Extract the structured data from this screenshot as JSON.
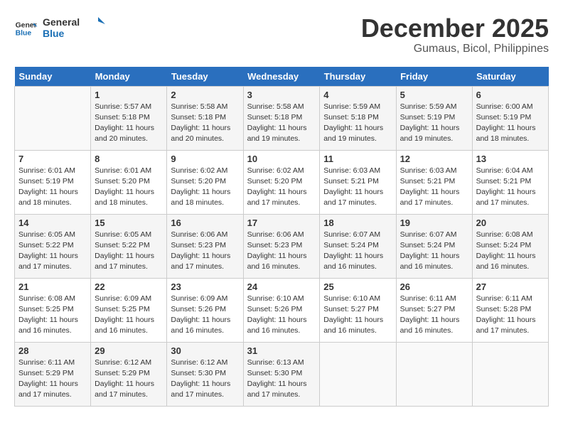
{
  "logo": {
    "line1": "General",
    "line2": "Blue"
  },
  "title": "December 2025",
  "location": "Gumaus, Bicol, Philippines",
  "days_header": [
    "Sunday",
    "Monday",
    "Tuesday",
    "Wednesday",
    "Thursday",
    "Friday",
    "Saturday"
  ],
  "weeks": [
    [
      {
        "day": "",
        "info": ""
      },
      {
        "day": "1",
        "info": "Sunrise: 5:57 AM\nSunset: 5:18 PM\nDaylight: 11 hours\nand 20 minutes."
      },
      {
        "day": "2",
        "info": "Sunrise: 5:58 AM\nSunset: 5:18 PM\nDaylight: 11 hours\nand 20 minutes."
      },
      {
        "day": "3",
        "info": "Sunrise: 5:58 AM\nSunset: 5:18 PM\nDaylight: 11 hours\nand 19 minutes."
      },
      {
        "day": "4",
        "info": "Sunrise: 5:59 AM\nSunset: 5:18 PM\nDaylight: 11 hours\nand 19 minutes."
      },
      {
        "day": "5",
        "info": "Sunrise: 5:59 AM\nSunset: 5:19 PM\nDaylight: 11 hours\nand 19 minutes."
      },
      {
        "day": "6",
        "info": "Sunrise: 6:00 AM\nSunset: 5:19 PM\nDaylight: 11 hours\nand 18 minutes."
      }
    ],
    [
      {
        "day": "7",
        "info": "Sunrise: 6:01 AM\nSunset: 5:19 PM\nDaylight: 11 hours\nand 18 minutes."
      },
      {
        "day": "8",
        "info": "Sunrise: 6:01 AM\nSunset: 5:20 PM\nDaylight: 11 hours\nand 18 minutes."
      },
      {
        "day": "9",
        "info": "Sunrise: 6:02 AM\nSunset: 5:20 PM\nDaylight: 11 hours\nand 18 minutes."
      },
      {
        "day": "10",
        "info": "Sunrise: 6:02 AM\nSunset: 5:20 PM\nDaylight: 11 hours\nand 17 minutes."
      },
      {
        "day": "11",
        "info": "Sunrise: 6:03 AM\nSunset: 5:21 PM\nDaylight: 11 hours\nand 17 minutes."
      },
      {
        "day": "12",
        "info": "Sunrise: 6:03 AM\nSunset: 5:21 PM\nDaylight: 11 hours\nand 17 minutes."
      },
      {
        "day": "13",
        "info": "Sunrise: 6:04 AM\nSunset: 5:21 PM\nDaylight: 11 hours\nand 17 minutes."
      }
    ],
    [
      {
        "day": "14",
        "info": "Sunrise: 6:05 AM\nSunset: 5:22 PM\nDaylight: 11 hours\nand 17 minutes."
      },
      {
        "day": "15",
        "info": "Sunrise: 6:05 AM\nSunset: 5:22 PM\nDaylight: 11 hours\nand 17 minutes."
      },
      {
        "day": "16",
        "info": "Sunrise: 6:06 AM\nSunset: 5:23 PM\nDaylight: 11 hours\nand 17 minutes."
      },
      {
        "day": "17",
        "info": "Sunrise: 6:06 AM\nSunset: 5:23 PM\nDaylight: 11 hours\nand 16 minutes."
      },
      {
        "day": "18",
        "info": "Sunrise: 6:07 AM\nSunset: 5:24 PM\nDaylight: 11 hours\nand 16 minutes."
      },
      {
        "day": "19",
        "info": "Sunrise: 6:07 AM\nSunset: 5:24 PM\nDaylight: 11 hours\nand 16 minutes."
      },
      {
        "day": "20",
        "info": "Sunrise: 6:08 AM\nSunset: 5:24 PM\nDaylight: 11 hours\nand 16 minutes."
      }
    ],
    [
      {
        "day": "21",
        "info": "Sunrise: 6:08 AM\nSunset: 5:25 PM\nDaylight: 11 hours\nand 16 minutes."
      },
      {
        "day": "22",
        "info": "Sunrise: 6:09 AM\nSunset: 5:25 PM\nDaylight: 11 hours\nand 16 minutes."
      },
      {
        "day": "23",
        "info": "Sunrise: 6:09 AM\nSunset: 5:26 PM\nDaylight: 11 hours\nand 16 minutes."
      },
      {
        "day": "24",
        "info": "Sunrise: 6:10 AM\nSunset: 5:26 PM\nDaylight: 11 hours\nand 16 minutes."
      },
      {
        "day": "25",
        "info": "Sunrise: 6:10 AM\nSunset: 5:27 PM\nDaylight: 11 hours\nand 16 minutes."
      },
      {
        "day": "26",
        "info": "Sunrise: 6:11 AM\nSunset: 5:27 PM\nDaylight: 11 hours\nand 16 minutes."
      },
      {
        "day": "27",
        "info": "Sunrise: 6:11 AM\nSunset: 5:28 PM\nDaylight: 11 hours\nand 17 minutes."
      }
    ],
    [
      {
        "day": "28",
        "info": "Sunrise: 6:11 AM\nSunset: 5:29 PM\nDaylight: 11 hours\nand 17 minutes."
      },
      {
        "day": "29",
        "info": "Sunrise: 6:12 AM\nSunset: 5:29 PM\nDaylight: 11 hours\nand 17 minutes."
      },
      {
        "day": "30",
        "info": "Sunrise: 6:12 AM\nSunset: 5:30 PM\nDaylight: 11 hours\nand 17 minutes."
      },
      {
        "day": "31",
        "info": "Sunrise: 6:13 AM\nSunset: 5:30 PM\nDaylight: 11 hours\nand 17 minutes."
      },
      {
        "day": "",
        "info": ""
      },
      {
        "day": "",
        "info": ""
      },
      {
        "day": "",
        "info": ""
      }
    ]
  ]
}
